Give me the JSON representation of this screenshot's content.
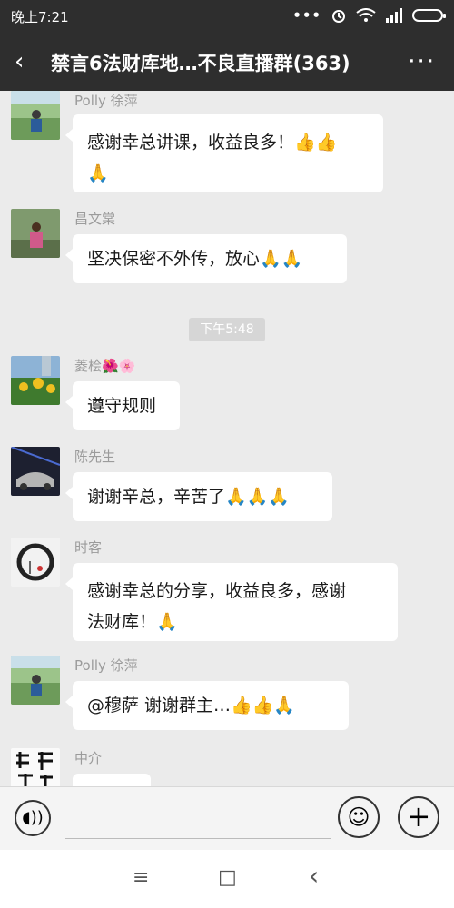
{
  "status_bar": {
    "time": "晚上7:21",
    "icons": [
      "more-dots-icon",
      "alarm-icon",
      "wifi-icon",
      "signal-icon",
      "battery-icon"
    ]
  },
  "title_bar": {
    "back_symbol": "‹",
    "title": "禁言6法财库地…不良直播群(363)",
    "more_symbol": "···"
  },
  "messages": [
    {
      "sender": "Polly 徐萍",
      "text_line1": "感谢幸总讲课，收益良多！👍👍",
      "text_line2": "🙏"
    },
    {
      "sender": "昌文棠",
      "text_line1": "坚决保密不外传，放心🙏🙏"
    },
    {
      "sender": "菱桧🌺🌸",
      "text_line1": "遵守规则"
    },
    {
      "sender": "陈先生",
      "text_line1": "谢谢辛总，辛苦了🙏🙏🙏"
    },
    {
      "sender": "时客",
      "text_line1": "感谢幸总的分享，收益良多，感谢",
      "text_line2": "法财库！🙏"
    },
    {
      "sender": "Polly 徐萍",
      "text_line1": "@穆萨  谢谢群主…👍👍🙏"
    },
    {
      "sender": "中介",
      "text_line1": "🙏🙏"
    }
  ],
  "time_divider": "下午5:48",
  "input_bar": {
    "voice_symbol": "◖))",
    "emoji_symbol": "☺",
    "plus_symbol": "+"
  },
  "nav_bar": {
    "menu_symbol": "≡",
    "home_symbol": "□",
    "back_symbol": "‹"
  },
  "colors": {
    "header_bg": "#2e2e2e",
    "chat_bg": "#ebebeb",
    "bubble_bg": "#ffffff",
    "sender_name": "#9b9b9b"
  }
}
